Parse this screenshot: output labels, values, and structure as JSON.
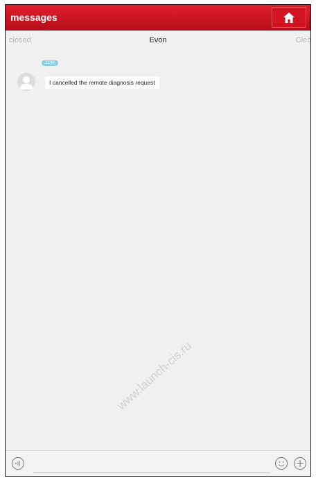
{
  "header": {
    "title": "messages"
  },
  "subbar": {
    "closed": "closed",
    "contact_name": "Evon",
    "clear": "Clear"
  },
  "conversation": {
    "timestamp": "11:34",
    "messages": [
      {
        "text": "I cancelled the remote diagnosis request"
      }
    ]
  },
  "watermark": "www.launch-cis.ru",
  "colors": {
    "header": "#c8101e",
    "timestamp_badge": "#8fd1e2",
    "background": "#f0f0f0"
  },
  "icons": {
    "home": "home-icon",
    "voice": "voice-icon",
    "emoji": "emoji-icon",
    "add": "plus-icon",
    "avatar": "user-avatar-icon"
  }
}
